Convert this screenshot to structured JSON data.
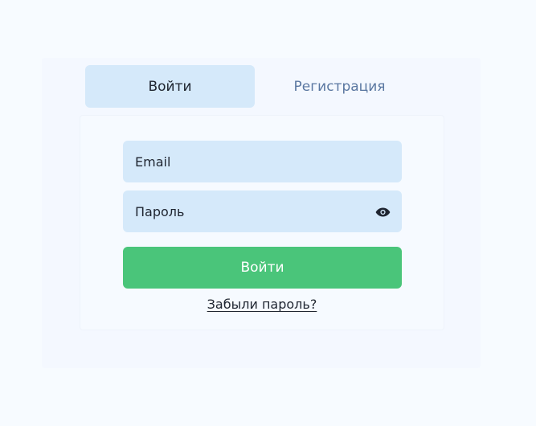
{
  "tabs": {
    "login_label": "Войти",
    "register_label": "Регистрация",
    "active": "login"
  },
  "form": {
    "email_placeholder": "Email",
    "password_placeholder": "Пароль",
    "submit_label": "Войти",
    "forgot_label": "Забыли пароль?"
  },
  "icons": {
    "password_toggle": "eye-icon"
  },
  "colors": {
    "background": "#f7fbff",
    "active_tab": "#d5e9fa",
    "inactive_tab_text": "#5a77a1",
    "input_background": "#d5e9fa",
    "primary_button": "#4ac57a",
    "text": "#1f2530"
  }
}
